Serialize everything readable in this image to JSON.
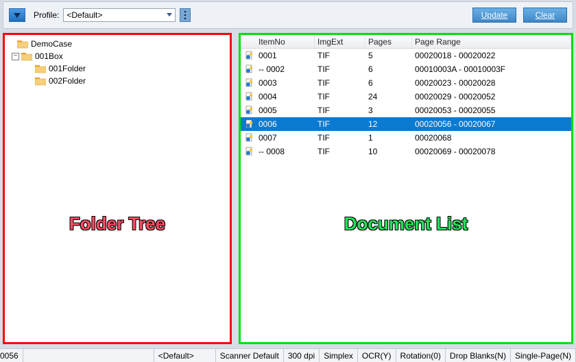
{
  "toolbar": {
    "profile_label": "Profile:",
    "profile_value": "<Default>",
    "update_label": "Update",
    "clear_label": "Clear"
  },
  "tree": {
    "root": {
      "name": "DemoCase"
    },
    "box": {
      "name": "001Box"
    },
    "folders": [
      {
        "name": "001Folder"
      },
      {
        "name": "002Folder"
      }
    ]
  },
  "table": {
    "headers": {
      "itemno": "ItemNo",
      "imgext": "ImgExt",
      "pages": "Pages",
      "range": "Page Range"
    },
    "rows": [
      {
        "itemno": "0001",
        "imgext": "TIF",
        "pages": "5",
        "range": "00020018 - 00020022",
        "selected": false
      },
      {
        "itemno": " -- 0002",
        "imgext": "TIF",
        "pages": "6",
        "range": "00010003A - 00010003F",
        "selected": false
      },
      {
        "itemno": "0003",
        "imgext": "TIF",
        "pages": "6",
        "range": "00020023 - 00020028",
        "selected": false
      },
      {
        "itemno": "0004",
        "imgext": "TIF",
        "pages": "24",
        "range": "00020029 - 00020052",
        "selected": false
      },
      {
        "itemno": "0005",
        "imgext": "TIF",
        "pages": "3",
        "range": "00020053 - 00020055",
        "selected": false
      },
      {
        "itemno": "0006",
        "imgext": "TIF",
        "pages": "12",
        "range": "00020056 - 00020067",
        "selected": true
      },
      {
        "itemno": "0007",
        "imgext": "TIF",
        "pages": "1",
        "range": "00020068",
        "selected": false
      },
      {
        "itemno": " -- 0008",
        "imgext": "TIF",
        "pages": "10",
        "range": "00020069 - 00020078",
        "selected": false
      }
    ]
  },
  "annotations": {
    "left": "Folder Tree",
    "right": "Document List"
  },
  "status": {
    "left_fragment": "0056",
    "profile": "<Default>",
    "scanner": "Scanner Default",
    "dpi": "300 dpi",
    "duplex": "Simplex",
    "ocr": "OCR(Y)",
    "rotation": "Rotation(0)",
    "blanks": "Drop Blanks(N)",
    "singlepage": "Single-Page(N)"
  },
  "icons": {
    "folder_color_tab": "#eca23a",
    "folder_color_body": "#f7cf7a",
    "doc_blue": "#2f7bd1",
    "doc_yellow": "#f4c430"
  }
}
